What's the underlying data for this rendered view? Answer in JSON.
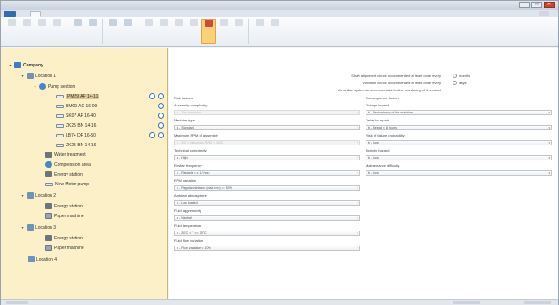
{
  "window": {
    "title": "",
    "controls": {
      "minimize": "–",
      "maximize": "□",
      "close": "✕"
    }
  },
  "menu": {
    "tabs": [
      {
        "label": "",
        "active": false
      },
      {
        "label": "",
        "active": true
      },
      {
        "label": "",
        "active": false
      },
      {
        "label": "",
        "active": false
      },
      {
        "label": "",
        "active": false
      }
    ],
    "help": ""
  },
  "tree": {
    "company": "Company",
    "location1": "Location 1",
    "pump_section": "Pump section",
    "assets": [
      "PM29 AF 14-11",
      "BM09 AC 16-09",
      "SK07 AF 16-40",
      "ZK25 BN 14-16",
      "LB74 DF 16-50",
      "ZK25 BN 14-16"
    ],
    "l1_items": [
      "Water treatment",
      "Compression area",
      "Energy station",
      "New Motor pump"
    ],
    "location2": "Location 2",
    "l2_items": [
      "Energy station",
      "Paper machine"
    ],
    "location3": "Location 3",
    "l3_items": [
      "Energy station",
      "Paper machine"
    ],
    "location4": "Location 4"
  },
  "content": {
    "notes": [
      "Shaft alignment check recommended at least once every",
      "Vibration check recommended at least once every",
      "An online system is recommended for the monitoring of this asset"
    ],
    "units": [
      "months",
      "days"
    ],
    "left_fields": [
      {
        "label": "Risk factors",
        "heading": true
      },
      {
        "label": "Assembly complexity",
        "value": "a - Two machines",
        "disabled": true
      },
      {
        "label": "Machine type",
        "value": "a - Standard"
      },
      {
        "label": "Maximum RPM of assembly",
        "value": "b - 200 < Maximum RPM < 3600",
        "disabled": true
      },
      {
        "label": "Technical complexity",
        "value": "a - High"
      },
      {
        "label": "Restart frequency",
        "value": "b - Restarts < x 1 / hour"
      },
      {
        "label": "RPM variation",
        "value": "b - Regular variation (max-min) <= 50%"
      },
      {
        "label": "Ambient atmosphere",
        "value": "b - Low loaded"
      },
      {
        "label": "Fluid aggressivity",
        "value": "a - Neutral"
      },
      {
        "label": "Fluid temperature",
        "value": "b - 20°C < T <= 75°C"
      },
      {
        "label": "Fluid flow variation",
        "value": "b - Flow variation < 10%"
      }
    ],
    "right_fields": [
      {
        "label": "Consequence factors",
        "heading": true
      },
      {
        "label": "Outage impact",
        "value": "b - Redundancy of the machine"
      },
      {
        "label": "Delay to repair",
        "value": "b - Repair < 8 hours"
      },
      {
        "label": "Risk of failure probability",
        "value": "b - Low"
      },
      {
        "label": "Toxicity hazard",
        "value": "b - Low"
      },
      {
        "label": "Maintenance difficulty",
        "value": "b - Low"
      }
    ]
  },
  "colors": {
    "sidebar_bg": "#fbf0c7",
    "accent_blue": "#2d6eb5",
    "active_button": "#f7d27a"
  }
}
